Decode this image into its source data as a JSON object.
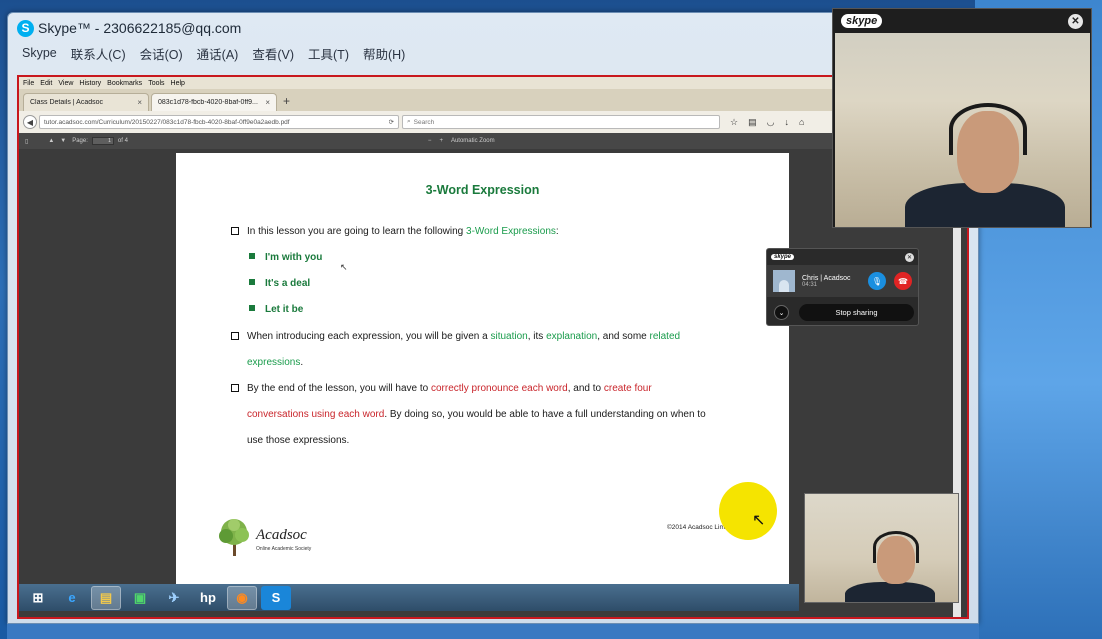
{
  "skype": {
    "title": "Skype™ - 2306622185@qq.com",
    "menu": [
      "Skype",
      "联系人(C)",
      "会话(O)",
      "通话(A)",
      "查看(V)",
      "工具(T)",
      "帮助(H)"
    ]
  },
  "firefox": {
    "menu": [
      "File",
      "Edit",
      "View",
      "History",
      "Bookmarks",
      "Tools",
      "Help"
    ],
    "tabs": [
      {
        "label": "Class Details | Acadsoc"
      },
      {
        "label": "083c1d78-fbcb-4020-8baf-0ff9..."
      }
    ],
    "new_tab": "+",
    "url": "tutor.acadsoc.com/Curriculum/20150227/083c1d78-fbcb-4020-8baf-0ff9e0a2aedb.pdf",
    "search_placeholder": "Search"
  },
  "pdf_toolbar": {
    "page_label": "Page:",
    "page_value": "1",
    "page_of": "of 4",
    "zoom": "Automatic Zoom",
    "zoom_minus": "−",
    "zoom_plus": "+"
  },
  "pdf": {
    "title": "3-Word Expression",
    "b1_pre": "In this lesson you are going to learn the following ",
    "b1_hl": "3-Word Expressions",
    "b1_post": ":",
    "expressions": [
      "I'm with you",
      "It's a deal",
      "Let it be"
    ],
    "b2_pre": "When introducing each expression, you will be given a ",
    "b2_hl1": "situation",
    "b2_mid1": ", its ",
    "b2_hl2": "explanation",
    "b2_mid2": ", and some ",
    "b2_hl3": "related",
    "b2_line2": "expressions",
    "b2_end": ".",
    "b3_pre": "By the end of the lesson, you will have to ",
    "b3_red1": "correctly pronounce each word",
    "b3_mid": ", and to ",
    "b3_red2": "create four",
    "b3_line2_red": "conversations using each word",
    "b3_line2_post": ". By doing so, you would be able to have a full understanding on when to",
    "b3_line3": "use those expressions.",
    "logo_name": "Acadsoc",
    "logo_tag": "Online Academic Society",
    "copyright": "©2014 Acadsoc Limited"
  },
  "video": {
    "badge": "skype"
  },
  "call": {
    "badge": "skype",
    "name": "Chris | Acadsoc",
    "time": "04:31",
    "stop_sharing": "Stop sharing"
  },
  "colors": {
    "accent_green": "#1a7a3c",
    "highlight_green": "#1a9c4c",
    "highlight_red": "#c9252b",
    "share_border": "#c8171e",
    "mic_blue": "#1a8fe0",
    "end_red": "#e02424"
  },
  "taskbar_icons": [
    "windows-start-icon",
    "internet-explorer-icon",
    "file-explorer-icon",
    "store-icon",
    "sword-icon",
    "hp-icon",
    "firefox-icon",
    "skype-icon"
  ]
}
